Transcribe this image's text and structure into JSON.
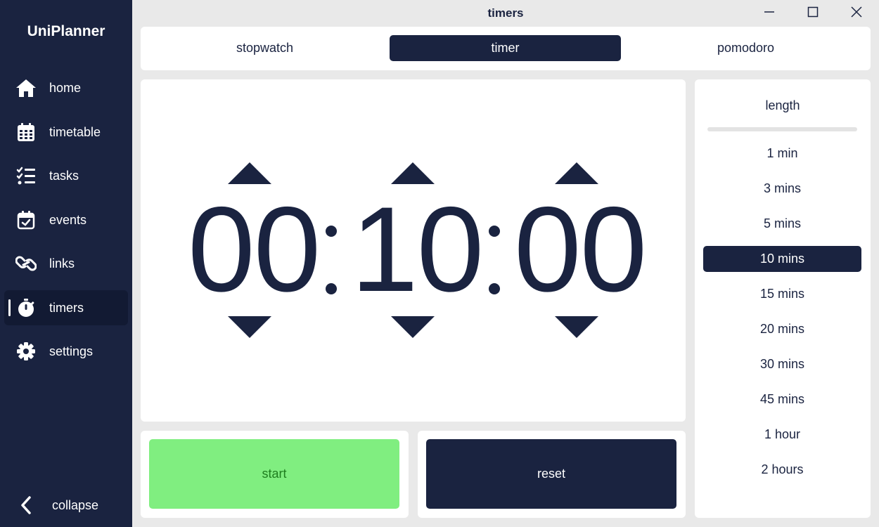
{
  "app": {
    "title": "UniPlanner"
  },
  "sidebar": {
    "items": [
      {
        "label": "home",
        "icon": "home-icon"
      },
      {
        "label": "timetable",
        "icon": "calendar-icon"
      },
      {
        "label": "tasks",
        "icon": "checklist-icon"
      },
      {
        "label": "events",
        "icon": "calendar-check-icon"
      },
      {
        "label": "links",
        "icon": "link-icon"
      },
      {
        "label": "timers",
        "icon": "stopwatch-icon",
        "active": true
      },
      {
        "label": "settings",
        "icon": "gear-icon"
      }
    ],
    "collapse_label": "collapse"
  },
  "window": {
    "title": "timers"
  },
  "tabs": [
    {
      "label": "stopwatch"
    },
    {
      "label": "timer",
      "active": true
    },
    {
      "label": "pomodoro"
    }
  ],
  "timer": {
    "hours": "00",
    "minutes": "10",
    "seconds": "00"
  },
  "actions": {
    "start_label": "start",
    "reset_label": "reset"
  },
  "length": {
    "title": "length",
    "options": [
      "1 min",
      "3 mins",
      "5 mins",
      "10 mins",
      "15 mins",
      "20 mins",
      "30 mins",
      "45 mins",
      "1 hour",
      "2 hours"
    ],
    "selected": "10 mins"
  },
  "colors": {
    "navy": "#1a2340",
    "start_green": "#80ee80",
    "panel_bg": "#e9e9e9"
  }
}
